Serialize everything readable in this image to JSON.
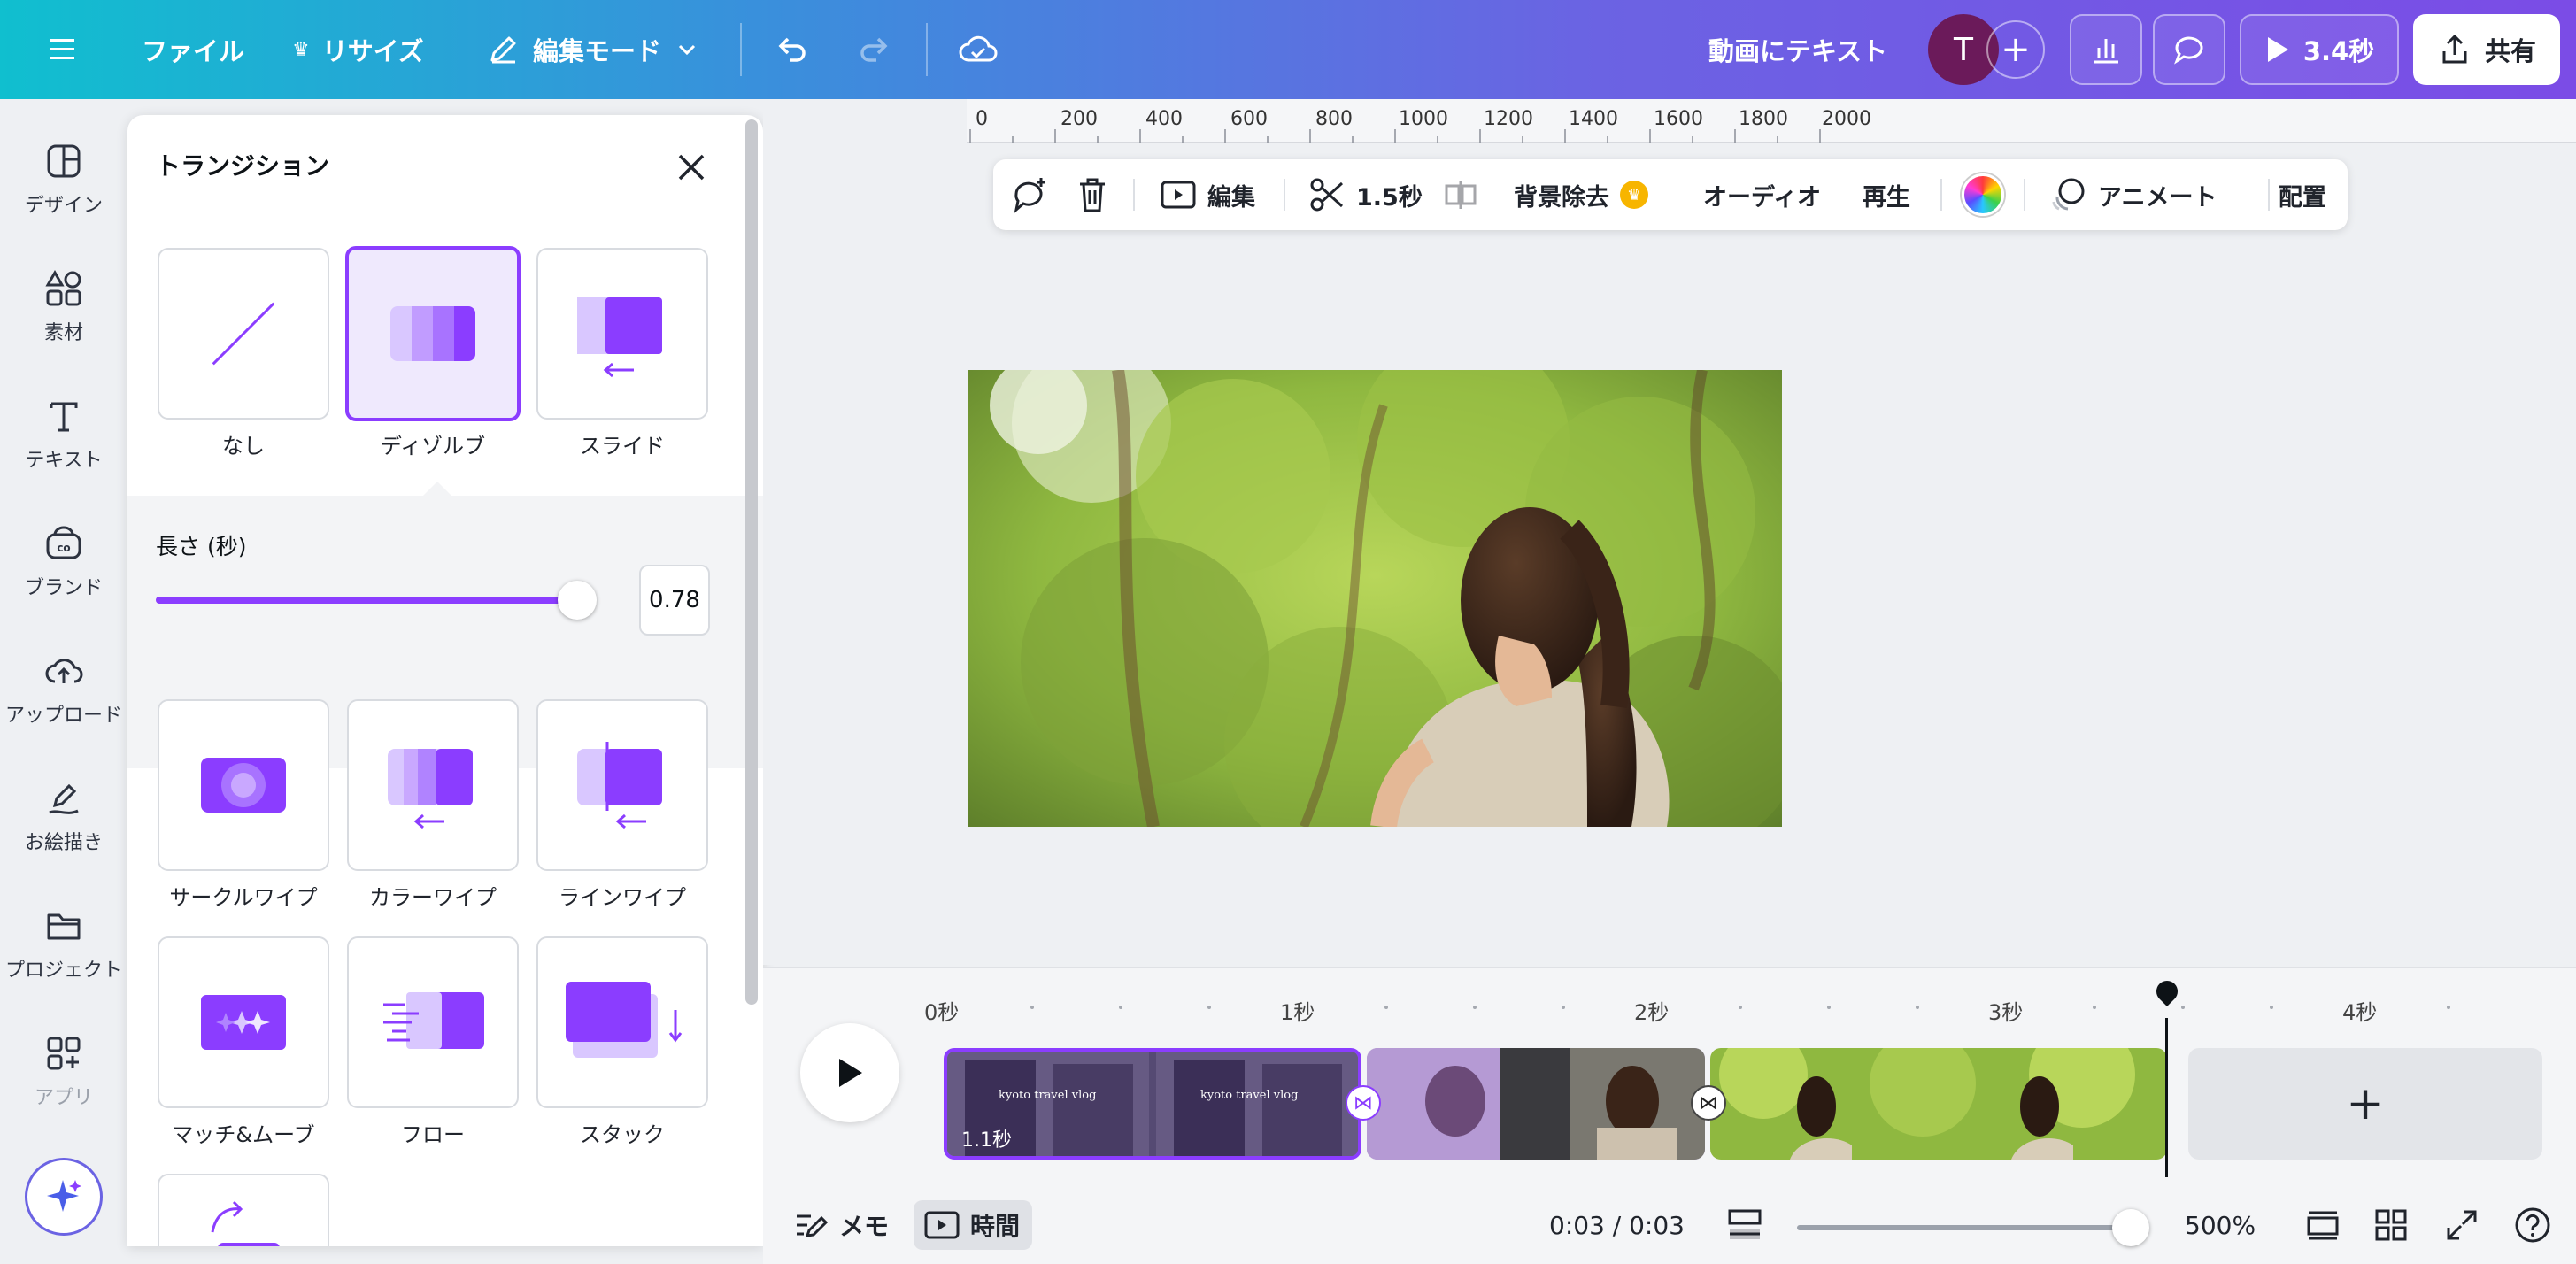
{
  "topbar": {
    "menu_icon": "hamburger-icon",
    "file": "ファイル",
    "resize": "リサイズ",
    "edit_mode": "編集モード",
    "doc_title": "動画にテキスト",
    "avatar_letter": "T",
    "play_time": "3.4秒",
    "share": "共有"
  },
  "leftnav": {
    "items": [
      {
        "label": "デザイン",
        "icon": "design-icon"
      },
      {
        "label": "素材",
        "icon": "elements-icon"
      },
      {
        "label": "テキスト",
        "icon": "text-icon"
      },
      {
        "label": "ブランド",
        "icon": "brand-icon"
      },
      {
        "label": "アップロード",
        "icon": "upload-icon"
      },
      {
        "label": "お絵描き",
        "icon": "draw-icon"
      },
      {
        "label": "プロジェクト",
        "icon": "folder-icon"
      },
      {
        "label": "アプリ",
        "icon": "apps-icon"
      }
    ]
  },
  "panel": {
    "title": "トランジション",
    "duration_label": "長さ (秒)",
    "duration_value": "0.78",
    "duration_fraction": 0.96,
    "top_tiles": [
      {
        "label": "なし"
      },
      {
        "label": "ディゾルブ",
        "selected": true
      },
      {
        "label": "スライド"
      }
    ],
    "tiles": [
      {
        "label": "サークルワイプ"
      },
      {
        "label": "カラーワイプ"
      },
      {
        "label": "ラインワイプ"
      },
      {
        "label": "マッチ&ムーブ"
      },
      {
        "label": "フロー"
      },
      {
        "label": "スタック"
      }
    ]
  },
  "ruler": {
    "ticks": [
      "0",
      "200",
      "400",
      "600",
      "800",
      "1000",
      "1200",
      "1400",
      "1600",
      "1800",
      "2000"
    ]
  },
  "toolbar": {
    "edit": "編集",
    "duration": "1.5秒",
    "bg_remove": "背景除去",
    "audio": "オーディオ",
    "playback": "再生",
    "animate": "アニメート",
    "arrange": "配置"
  },
  "timeline": {
    "ticks": [
      "0秒",
      "1秒",
      "2秒",
      "3秒",
      "4秒"
    ],
    "clip1_overlay_text": "kyoto travel vlog",
    "clip1_duration": "1.1秒",
    "add_label": "+"
  },
  "bottombar": {
    "notes": "メモ",
    "time": "時間",
    "timecode": "0:03 / 0:03",
    "zoom": "500%"
  },
  "colors": {
    "accent": "#8b3dff",
    "accent_light": "#c9a8ff"
  }
}
